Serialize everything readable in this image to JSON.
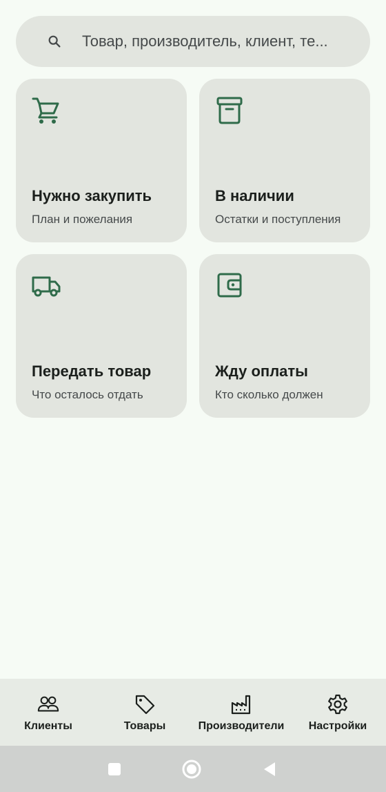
{
  "search": {
    "placeholder": "Товар, производитель, клиент, те..."
  },
  "cards": [
    {
      "title": "Нужно закупить",
      "subtitle": "План и пожелания",
      "icon": "cart-icon"
    },
    {
      "title": "В наличии",
      "subtitle": "Остатки и поступления",
      "icon": "archive-box-icon"
    },
    {
      "title": "Передать товар",
      "subtitle": "Что осталось отдать",
      "icon": "truck-icon"
    },
    {
      "title": "Жду оплаты",
      "subtitle": "Кто сколько должен",
      "icon": "wallet-icon"
    }
  ],
  "bottom_nav": [
    {
      "label": "Клиенты",
      "icon": "people-icon"
    },
    {
      "label": "Товары",
      "icon": "tag-icon"
    },
    {
      "label": "Производители",
      "icon": "factory-icon"
    },
    {
      "label": "Настройки",
      "icon": "gear-icon"
    }
  ],
  "system_nav": [
    "recents-square-icon",
    "home-circle-icon",
    "back-triangle-icon"
  ],
  "colors": {
    "background": "#f6fbf5",
    "surface": "#e2e5df",
    "accent": "#2f6b4a",
    "nav_bar": "#e7ebe5",
    "system_bar": "#cfd1cf"
  }
}
